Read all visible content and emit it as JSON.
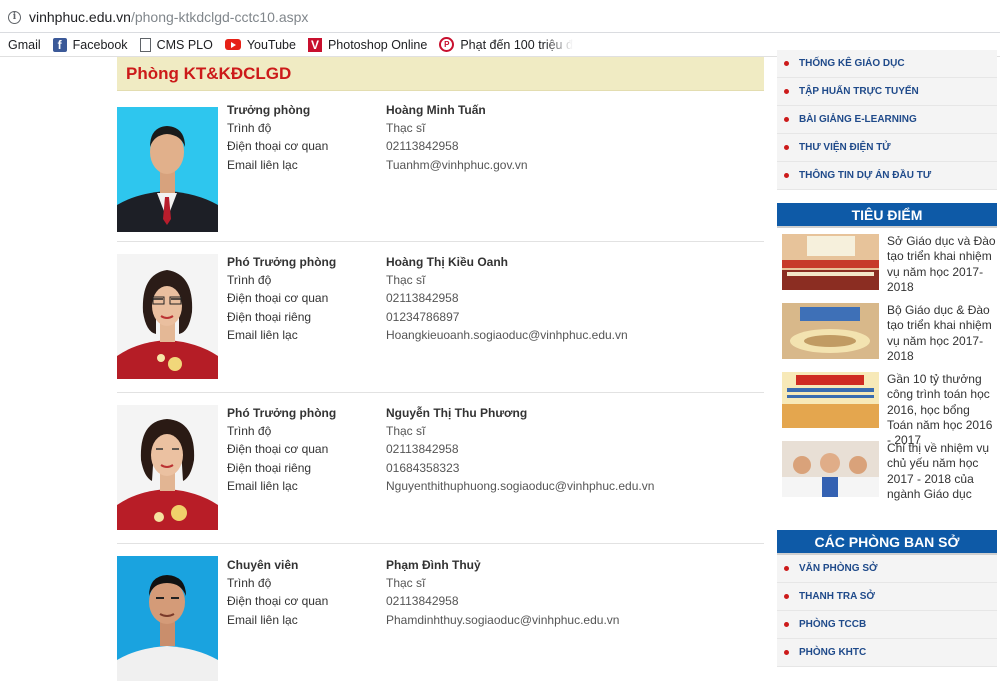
{
  "browser": {
    "url_domain": "vinhphuc.edu.vn",
    "url_path": "/phong-ktkdclgd-cctc10.aspx",
    "bookmarks": [
      {
        "label": "Gmail",
        "icon": "gmail"
      },
      {
        "label": "Facebook",
        "icon": "facebook-icon"
      },
      {
        "label": "CMS PLO",
        "icon": "page-icon"
      },
      {
        "label": "YouTube",
        "icon": "youtube-icon"
      },
      {
        "label": "Photoshop Online",
        "icon": "photoshop-icon"
      },
      {
        "label": "Phạt đến 100 triệu đ",
        "icon": "news-site-icon"
      }
    ]
  },
  "main": {
    "title": "Phòng KT&KĐCLGD",
    "staff": [
      {
        "rows": [
          {
            "label": "Trưởng phòng",
            "value": "Hoàng Minh Tuấn"
          },
          {
            "label": "Trình độ",
            "value": "Thạc sĩ"
          },
          {
            "label": "Điện thoại cơ quan",
            "value": "02113842958"
          },
          {
            "label": "Email liên lạc",
            "value": "Tuanhm@vinhphuc.gov.vn"
          }
        ]
      },
      {
        "rows": [
          {
            "label": "Phó Trưởng phòng",
            "value": "Hoàng Thị Kiều Oanh"
          },
          {
            "label": "Trình độ",
            "value": "Thạc sĩ"
          },
          {
            "label": "Điện thoại cơ quan",
            "value": "02113842958"
          },
          {
            "label": "Điện thoại riêng",
            "value": "01234786897"
          },
          {
            "label": "Email liên lạc",
            "value": "Hoangkieuoanh.sogiaoduc@vinhphuc.edu.vn"
          }
        ]
      },
      {
        "rows": [
          {
            "label": "Phó Trưởng phòng",
            "value": "Nguyễn Thị Thu Phương"
          },
          {
            "label": "Trình độ",
            "value": "Thạc sĩ"
          },
          {
            "label": "Điện thoại cơ quan",
            "value": "02113842958"
          },
          {
            "label": "Điện thoại riêng",
            "value": "01684358323"
          },
          {
            "label": "Email liên lạc",
            "value": "Nguyenthithuphuong.sogiaoduc@vinhphuc.edu.vn"
          }
        ]
      },
      {
        "rows": [
          {
            "label": "Chuyên viên",
            "value": "Phạm Đình Thuỷ"
          },
          {
            "label": "Trình độ",
            "value": "Thạc sĩ"
          },
          {
            "label": "Điện thoại cơ quan",
            "value": "02113842958"
          },
          {
            "label": "Email liên lạc",
            "value": "Phamdinhthuy.sogiaoduc@vinhphuc.edu.vn"
          }
        ]
      }
    ]
  },
  "sidebar": {
    "top_menu": [
      "THỐNG KÊ GIÁO DỤC",
      "TẬP HUẤN TRỰC TUYẾN",
      "BÀI GIẢNG E-LEARNING",
      "THƯ VIỆN ĐIỆN TỬ",
      "THÔNG TIN DỰ ÁN ĐẦU TƯ"
    ],
    "highlights_title": "TIÊU ĐIỂM",
    "highlights": [
      {
        "text": "Sở Giáo dục và Đào tạo triển khai nhiệm vụ năm học 2017-2018"
      },
      {
        "text": "Bộ Giáo dục & Đào tạo triển khai nhiệm vụ năm học 2017-2018"
      },
      {
        "text": "Gần 10 tỷ thưởng công trình toán học 2016, học bổng Toán năm học 2016 - 2017"
      },
      {
        "text": "Chỉ thị về nhiệm vụ chủ yếu năm học 2017 - 2018 của ngành Giáo dục"
      }
    ],
    "departments_title": "CÁC PHÒNG BAN SỞ",
    "departments": [
      "VĂN PHÒNG SỞ",
      "THANH TRA SỞ",
      "PHÒNG TCCB",
      "PHÒNG KHTC"
    ]
  },
  "colors": {
    "accent_red": "#cc1a1a",
    "header_blue": "#0e5aa7",
    "title_bg": "#f0ebc3"
  }
}
